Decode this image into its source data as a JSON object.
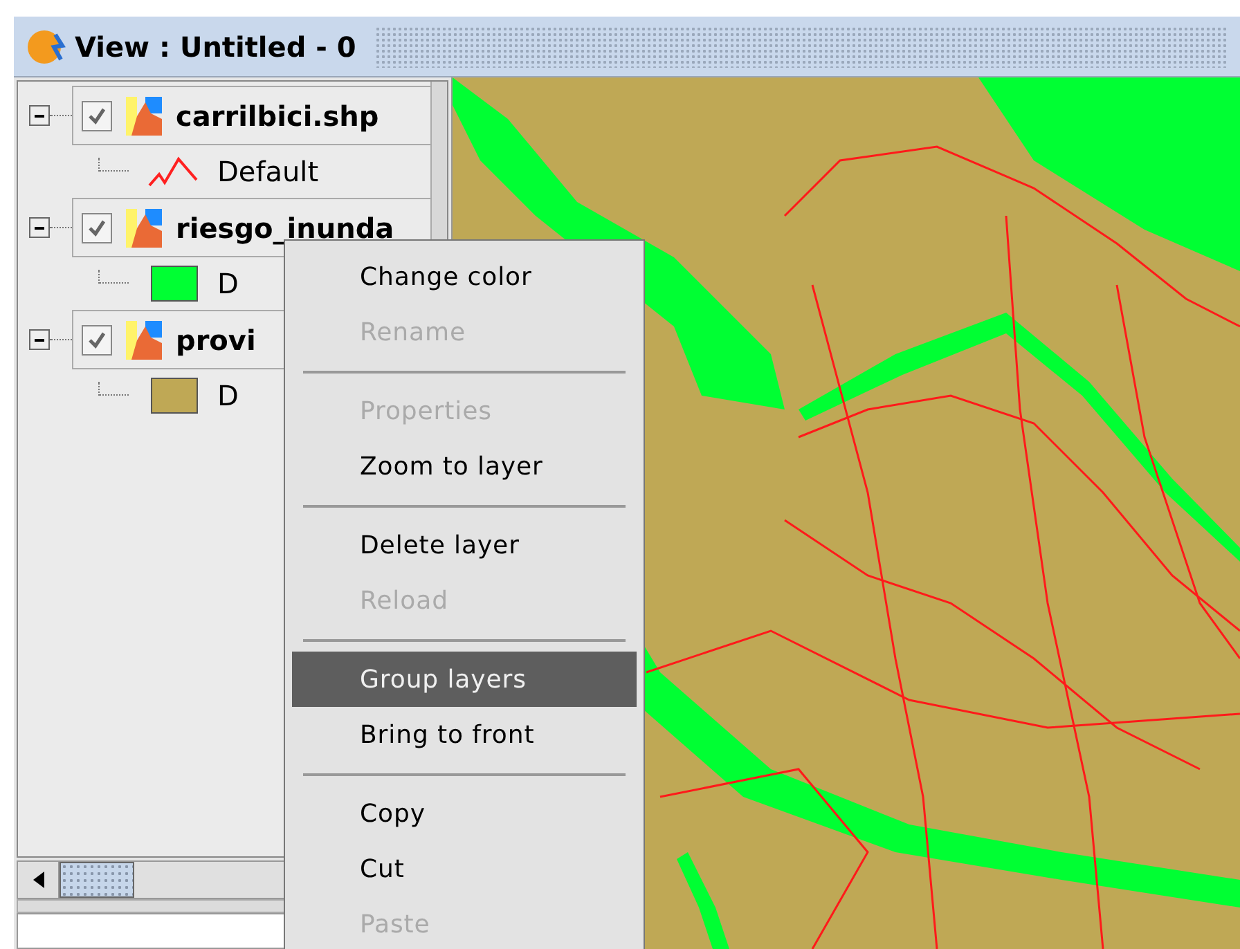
{
  "window": {
    "title": "View : Untitled - 0"
  },
  "layers": [
    {
      "name": "carrilbici.shp",
      "checked": true,
      "expanded": true,
      "legend": [
        {
          "kind": "line",
          "color": "#ff2020",
          "label": "Default"
        }
      ]
    },
    {
      "name": "riesgo_inunda",
      "checked": true,
      "expanded": true,
      "legend": [
        {
          "kind": "fill",
          "color": "#00ff33",
          "label": "D"
        }
      ]
    },
    {
      "name": "provi",
      "checked": true,
      "expanded": true,
      "legend": [
        {
          "kind": "fill",
          "color": "#bfa855",
          "label": "D"
        }
      ]
    }
  ],
  "context_menu": [
    {
      "kind": "item",
      "label": "Change color",
      "disabled": false,
      "selected": false
    },
    {
      "kind": "item",
      "label": "Rename",
      "disabled": true,
      "selected": false
    },
    {
      "kind": "separator"
    },
    {
      "kind": "item",
      "label": "Properties",
      "disabled": true,
      "selected": false
    },
    {
      "kind": "item",
      "label": "Zoom to layer",
      "disabled": false,
      "selected": false
    },
    {
      "kind": "separator"
    },
    {
      "kind": "item",
      "label": "Delete layer",
      "disabled": false,
      "selected": false
    },
    {
      "kind": "item",
      "label": "Reload",
      "disabled": true,
      "selected": false
    },
    {
      "kind": "separator"
    },
    {
      "kind": "item",
      "label": "Group layers",
      "disabled": false,
      "selected": true
    },
    {
      "kind": "item",
      "label": "Bring to front",
      "disabled": false,
      "selected": false
    },
    {
      "kind": "separator"
    },
    {
      "kind": "item",
      "label": "Copy",
      "disabled": false,
      "selected": false
    },
    {
      "kind": "item",
      "label": "Cut",
      "disabled": false,
      "selected": false
    },
    {
      "kind": "item",
      "label": "Paste",
      "disabled": true,
      "selected": false
    }
  ]
}
